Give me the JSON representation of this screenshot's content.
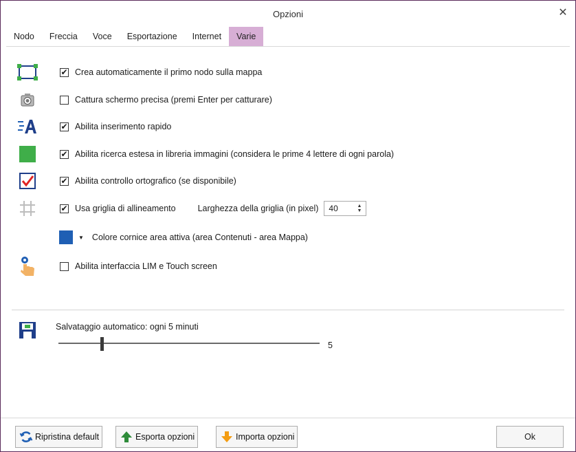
{
  "window": {
    "title": "Opzioni",
    "close_label": "✕"
  },
  "tabs": [
    {
      "label": "Nodo",
      "active": false
    },
    {
      "label": "Freccia",
      "active": false
    },
    {
      "label": "Voce",
      "active": false
    },
    {
      "label": "Esportazione",
      "active": false
    },
    {
      "label": "Internet",
      "active": false
    },
    {
      "label": "Varie",
      "active": true
    }
  ],
  "options": [
    {
      "icon": "node-frame-icon",
      "checked": true,
      "label": "Crea automaticamente il primo nodo sulla mappa"
    },
    {
      "icon": "camera-icon",
      "checked": false,
      "label": "Cattura schermo precisa (premi Enter per catturare)"
    },
    {
      "icon": "quick-insert-icon",
      "checked": true,
      "label": "Abilita inserimento rapido"
    },
    {
      "icon": "image-library-icon",
      "checked": true,
      "label": "Abilita ricerca estesa in libreria immagini (considera le prime 4 lettere di ogni parola)"
    },
    {
      "icon": "spellcheck-icon",
      "checked": true,
      "label": "Abilita controllo ortografico (se disponibile)"
    },
    {
      "icon": "grid-icon",
      "checked": true,
      "label": "Usa griglia di allineamento"
    },
    {
      "icon": "touch-icon",
      "checked": false,
      "label": "Abilita interfaccia LIM e Touch screen"
    }
  ],
  "grid_width": {
    "label": "Larghezza della griglia (in pixel)",
    "value": "40"
  },
  "frame_color": {
    "label": "Colore cornice area attiva (area Contenuti - area Mappa)",
    "color": "#1f5fb4"
  },
  "autosave": {
    "label": "Salvataggio automatico: ogni 5 minuti",
    "value": "5",
    "min": 0,
    "max": 30,
    "level": 5
  },
  "footer": {
    "reset_label": "Ripristina default",
    "export_label": "Esporta opzioni",
    "import_label": "Importa opzioni",
    "ok_label": "Ok"
  },
  "colors": {
    "active_tab": "#d7aed5",
    "window_border": "#5a2a5a"
  }
}
